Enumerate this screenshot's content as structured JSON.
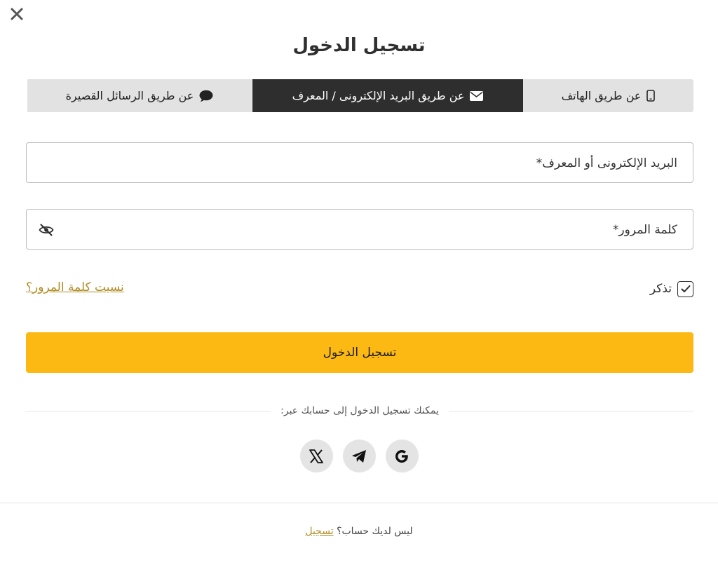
{
  "modal": {
    "title": "تسجيل الدخول"
  },
  "tabs": [
    {
      "label": "عن طريق الهاتف",
      "icon": "mobile-phone-icon",
      "active": false
    },
    {
      "label": "عن طريق البريد الإلكترونى / المعرف",
      "icon": "envelope-icon",
      "active": true
    },
    {
      "label": "عن طريق الرسائل القصيرة",
      "icon": "chat-bubble-icon",
      "active": false
    }
  ],
  "form": {
    "email_label": "البريد الإلكترونى أو المعرف*",
    "email_value": "",
    "password_label": "كلمة المرور*",
    "password_value": "",
    "remember_label": "تذكر",
    "remember_checked": true,
    "forgot_link": "نسيت كلمة المرور؟",
    "submit_label": "تسجيل الدخول"
  },
  "social": {
    "divider_text": "يمكنك تسجيل الدخول إلى حسابك عبر:",
    "providers": [
      "x-logo-icon",
      "telegram-icon",
      "google-icon"
    ]
  },
  "footer": {
    "question": "ليس لديك حساب؟",
    "register_link": "تسجيل"
  },
  "colors": {
    "accent": "#fdb913",
    "active_tab_bg": "#2e2e2e",
    "inactive_tab_bg": "#e2e2e2",
    "link": "#b08a20"
  }
}
